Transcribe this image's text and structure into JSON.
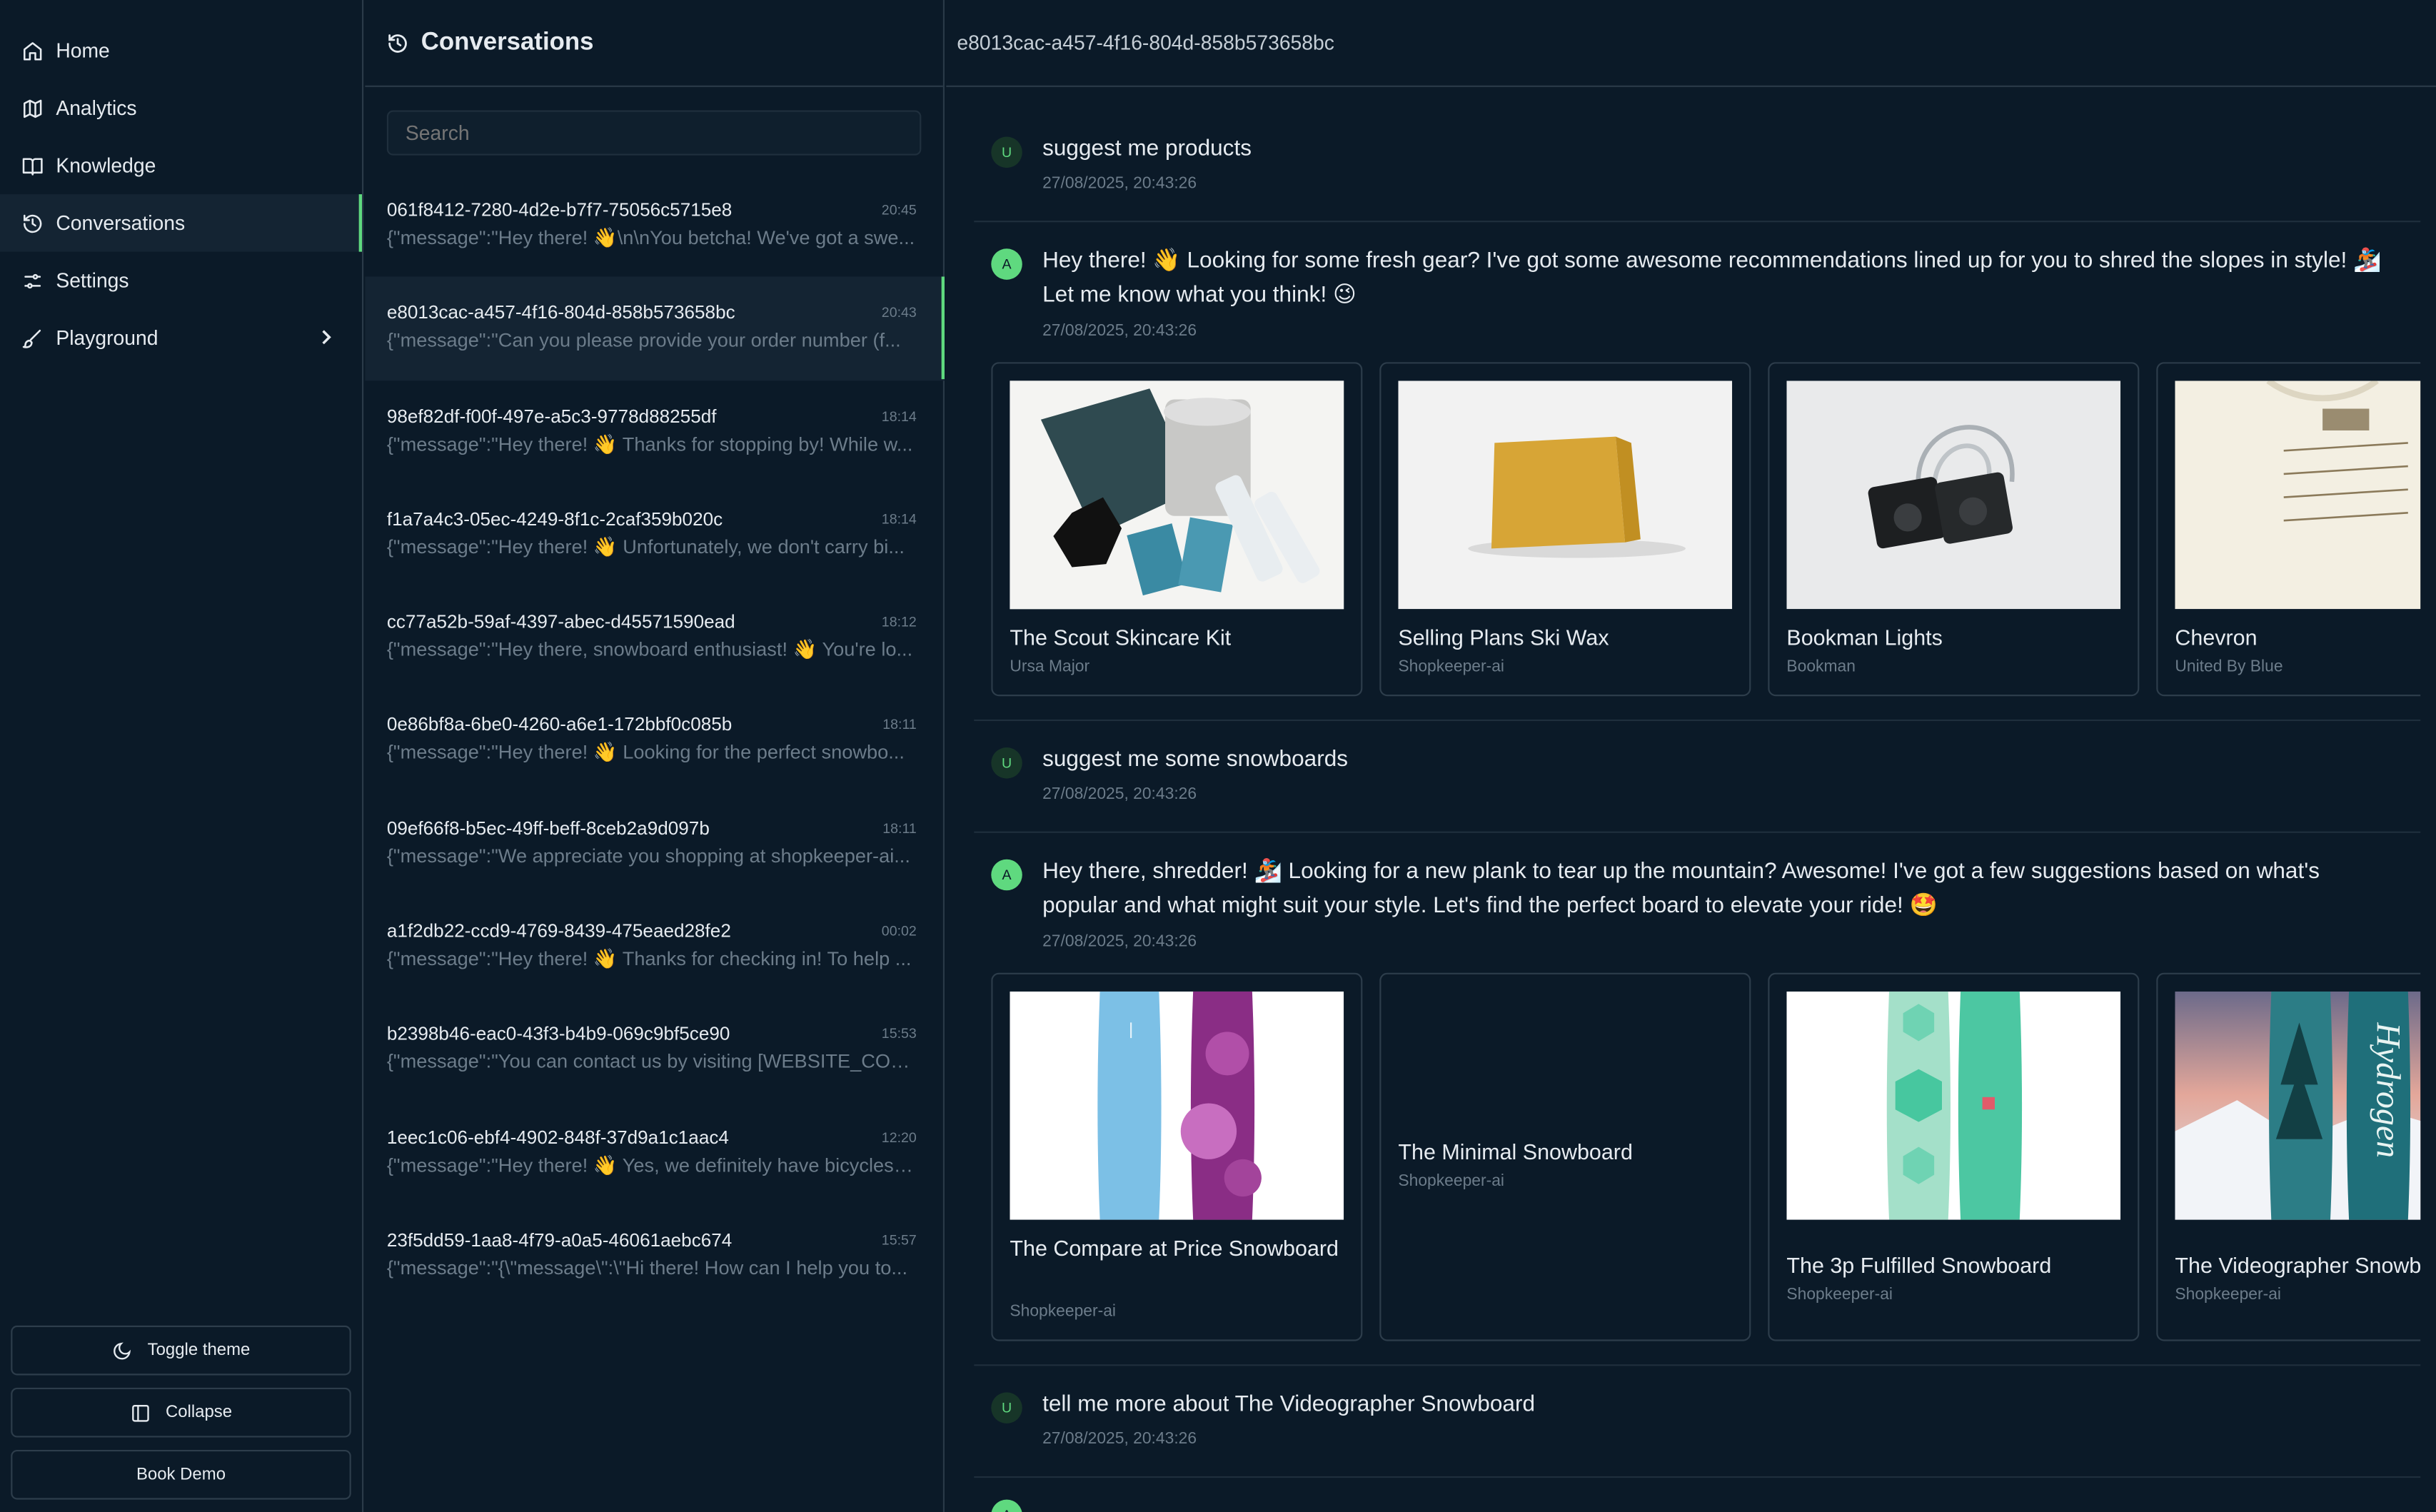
{
  "sidebar": {
    "items": [
      {
        "label": "Home",
        "icon": "home-icon"
      },
      {
        "label": "Analytics",
        "icon": "map-icon"
      },
      {
        "label": "Knowledge",
        "icon": "book-icon"
      },
      {
        "label": "Conversations",
        "icon": "history-icon",
        "active": true
      },
      {
        "label": "Settings",
        "icon": "sliders-icon"
      },
      {
        "label": "Playground",
        "icon": "brush-icon"
      }
    ],
    "toggle_theme": "Toggle theme",
    "collapse": "Collapse",
    "book_demo": "Book Demo"
  },
  "conversations": {
    "title": "Conversations",
    "search_placeholder": "Search",
    "items": [
      {
        "id": "061f8412-7280-4d2e-b7f7-75056c5715e8",
        "time": "20:45",
        "preview": "{\"message\":\"Hey there! 👋\\n\\nYou betcha! We've got a swe..."
      },
      {
        "id": "e8013cac-a457-4f16-804d-858b573658bc",
        "time": "20:43",
        "preview": "{\"message\":\"Can you please provide your order number (f..."
      },
      {
        "id": "98ef82df-f00f-497e-a5c3-9778d88255df",
        "time": "18:14",
        "preview": "{\"message\":\"Hey there! 👋 Thanks for stopping by! While w..."
      },
      {
        "id": "f1a7a4c3-05ec-4249-8f1c-2caf359b020c",
        "time": "18:14",
        "preview": "{\"message\":\"Hey there! 👋 Unfortunately, we don't carry bi..."
      },
      {
        "id": "cc77a52b-59af-4397-abec-d45571590ead",
        "time": "18:12",
        "preview": "{\"message\":\"Hey there, snowboard enthusiast! 👋 You're lo..."
      },
      {
        "id": "0e86bf8a-6be0-4260-a6e1-172bbf0c085b",
        "time": "18:11",
        "preview": "{\"message\":\"Hey there! 👋 Looking for the perfect snowbo..."
      },
      {
        "id": "09ef66f8-b5ec-49ff-beff-8ceb2a9d097b",
        "time": "18:11",
        "preview": "{\"message\":\"We appreciate you shopping at shopkeeper-ai..."
      },
      {
        "id": "a1f2db22-ccd9-4769-8439-475eaed28fe2",
        "time": "00:02",
        "preview": "{\"message\":\"Hey there! 👋 Thanks for checking in! To help ..."
      },
      {
        "id": "b2398b46-eac0-43f3-b4b9-069c9bf5ce90",
        "time": "15:53",
        "preview": "{\"message\":\"You can contact us by visiting [WEBSITE_CON..."
      },
      {
        "id": "1eec1c06-ebf4-4902-848f-37d9a1c1aac4",
        "time": "12:20",
        "preview": "{\"message\":\"Hey there! 👋 Yes, we definitely have bicycles! ..."
      },
      {
        "id": "23f5dd59-1aa8-4f79-a0a5-46061aebc674",
        "time": "15:57",
        "preview": "{\"message\":\"{\\\"message\\\":\\\"Hi there! How can I help you to..."
      }
    ]
  },
  "chat": {
    "conversation_id": "e8013cac-a457-4f16-804d-858b573658bc",
    "messages": [
      {
        "role": "U",
        "text": "suggest me products",
        "time": "27/08/2025, 20:43:26"
      },
      {
        "role": "A",
        "text": "Hey there! 👋 Looking for some fresh gear? I've got some awesome recommendations lined up for you to shred the slopes in style! 🏂 Let me know what you think! 😉",
        "time": "27/08/2025, 20:43:26"
      },
      {
        "role": "U",
        "text": "suggest me some snowboards",
        "time": "27/08/2025, 20:43:26"
      },
      {
        "role": "A",
        "text": "Hey there, shredder! 🏂 Looking for a new plank to tear up the mountain? Awesome! I've got a few suggestions based on what's popular and what might suit your style. Let's find the perfect board to elevate your ride! 🤩",
        "time": "27/08/2025, 20:43:26"
      },
      {
        "role": "U",
        "text": "tell me more about The Videographer Snowboard",
        "time": "27/08/2025, 20:43:26"
      }
    ],
    "products_1": [
      {
        "title": "The Scout Skincare Kit",
        "brand": "Ursa Major"
      },
      {
        "title": "Selling Plans Ski Wax",
        "brand": "Shopkeeper-ai"
      },
      {
        "title": "Bookman Lights",
        "brand": "Bookman"
      },
      {
        "title": "Chevron",
        "brand": "United By Blue"
      }
    ],
    "products_2": [
      {
        "title": "The Compare at Price Snowboard",
        "brand": "Shopkeeper-ai"
      },
      {
        "title": "The Minimal Snowboard",
        "brand": "Shopkeeper-ai"
      },
      {
        "title": "The 3p Fulfilled Snowboard",
        "brand": "Shopkeeper-ai"
      },
      {
        "title": "The Videographer Snowboard",
        "brand": "Shopkeeper-ai"
      }
    ]
  }
}
